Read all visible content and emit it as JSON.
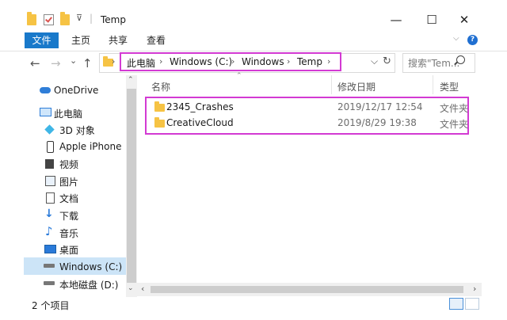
{
  "titlebar": {
    "title": "Temp",
    "minimize": "—",
    "maximize": "☐",
    "close": "✕"
  },
  "ribbon": {
    "file": "文件",
    "home": "主页",
    "share": "共享",
    "view": "查看",
    "help": "?",
    "expand": "⌵"
  },
  "nav": {
    "back": "←",
    "forward": "→",
    "recent": "⌄",
    "up": "↑",
    "dropdown": "⌵",
    "refresh": "↻"
  },
  "breadcrumb": [
    "此电脑",
    "Windows (C:)",
    "Windows",
    "Temp"
  ],
  "search": {
    "placeholder": "搜索\"Tem..."
  },
  "sidebar": {
    "items": [
      {
        "label": "OneDrive",
        "icon": "cloud-icon"
      },
      {
        "label": "此电脑",
        "icon": "computer-icon"
      },
      {
        "label": "3D 对象",
        "icon": "cube-icon"
      },
      {
        "label": "Apple iPhone",
        "icon": "phone-icon"
      },
      {
        "label": "视频",
        "icon": "video-icon"
      },
      {
        "label": "图片",
        "icon": "picture-icon"
      },
      {
        "label": "文档",
        "icon": "document-icon"
      },
      {
        "label": "下载",
        "icon": "download-icon"
      },
      {
        "label": "音乐",
        "icon": "music-icon"
      },
      {
        "label": "桌面",
        "icon": "desktop-icon"
      },
      {
        "label": "Windows (C:)",
        "icon": "drive-icon"
      },
      {
        "label": "本地磁盘 (D:)",
        "icon": "drive-icon"
      }
    ]
  },
  "columns": {
    "name": "名称",
    "date": "修改日期",
    "type": "类型"
  },
  "files": [
    {
      "name": "2345_Crashes",
      "date": "2019/12/17 12:54",
      "type": "文件夹"
    },
    {
      "name": "CreativeCloud",
      "date": "2019/8/29 19:38",
      "type": "文件夹"
    }
  ],
  "status": {
    "count": "2 个项目"
  }
}
